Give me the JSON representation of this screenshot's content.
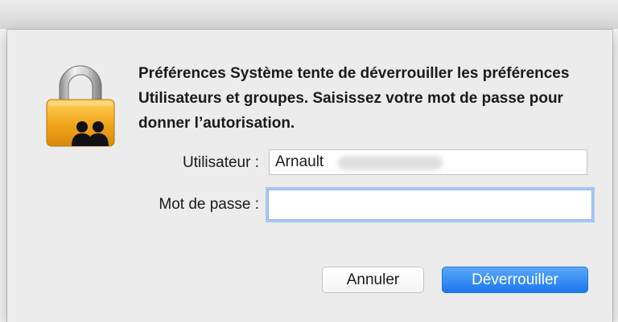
{
  "dialog": {
    "message": "Préférences Système tente de déverrouiller les préférences Utilisateurs et groupes. Saisissez votre mot de passe pour donner l’autorisation.",
    "icon": "lock-users-icon"
  },
  "form": {
    "username_label": "Utilisateur :",
    "username_value": "Arnault",
    "password_label": "Mot de passe :",
    "password_value": ""
  },
  "buttons": {
    "cancel_label": "Annuler",
    "unlock_label": "Déverrouiller"
  },
  "colors": {
    "accent": "#1f7bf0",
    "focus_ring": "#a9c8f0",
    "sheet_background": "#ececec"
  }
}
